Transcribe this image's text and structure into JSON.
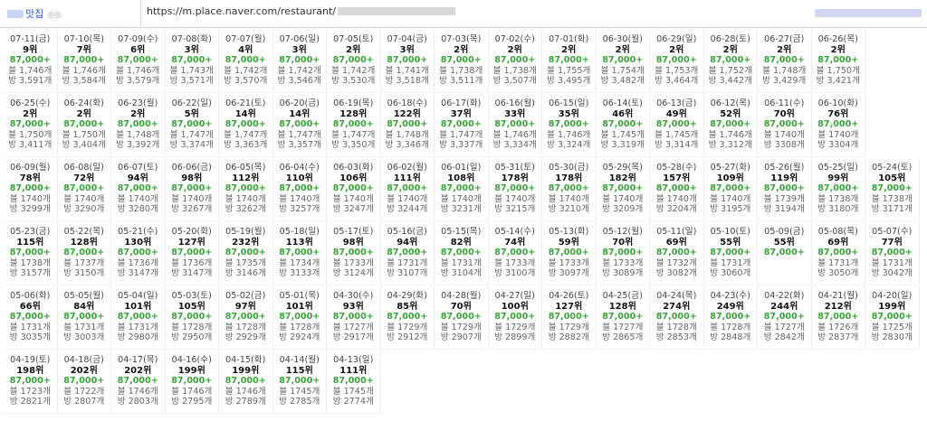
{
  "header": {
    "brand_label": "맛집",
    "brand_extra": "◎◎",
    "url": "https://m.place.naver.com/restaurant/"
  },
  "rows": [
    [
      {
        "date": "07-11(금)",
        "rank": "9위",
        "price": "87,000+",
        "blog": "블 1,746개",
        "visit": "방 3,591개"
      },
      {
        "date": "07-10(목)",
        "rank": "7위",
        "price": "87,000+",
        "blog": "블 1,746개",
        "visit": "방 3,584개"
      },
      {
        "date": "07-09(수)",
        "rank": "6위",
        "price": "87,000+",
        "blog": "블 1,746개",
        "visit": "방 3,579개"
      },
      {
        "date": "07-08(화)",
        "rank": "3위",
        "price": "87,000+",
        "blog": "블 1,743개",
        "visit": "방 3,571개"
      },
      {
        "date": "07-07(월)",
        "rank": "4위",
        "price": "87,000+",
        "blog": "블 1,742개",
        "visit": "방 3,570개"
      },
      {
        "date": "07-06(일)",
        "rank": "3위",
        "price": "87,000+",
        "blog": "블 1,742개",
        "visit": "방 3,546개"
      },
      {
        "date": "07-05(토)",
        "rank": "2위",
        "price": "87,000+",
        "blog": "블 1,742개",
        "visit": "방 3,530개"
      },
      {
        "date": "07-04(금)",
        "rank": "3위",
        "price": "87,000+",
        "blog": "블 1,741개",
        "visit": "방 3,518개"
      },
      {
        "date": "07-03(목)",
        "rank": "2위",
        "price": "87,000+",
        "blog": "블 1,738개",
        "visit": "방 3,511개"
      },
      {
        "date": "07-02(수)",
        "rank": "2위",
        "price": "87,000+",
        "blog": "블 1,738개",
        "visit": "방 3,507개"
      },
      {
        "date": "07-01(화)",
        "rank": "2위",
        "price": "87,000+",
        "blog": "블 1,755개",
        "visit": "방 3,495개"
      },
      {
        "date": "06-30(월)",
        "rank": "2위",
        "price": "87,000+",
        "blog": "블 1,754개",
        "visit": "방 3,482개"
      },
      {
        "date": "06-29(일)",
        "rank": "2위",
        "price": "87,000+",
        "blog": "블 1,753개",
        "visit": "방 3,464개"
      },
      {
        "date": "06-28(토)",
        "rank": "2위",
        "price": "87,000+",
        "blog": "블 1,752개",
        "visit": "방 3,442개"
      },
      {
        "date": "06-27(금)",
        "rank": "2위",
        "price": "87,000+",
        "blog": "블 1,748개",
        "visit": "방 3,429개"
      },
      {
        "date": "06-26(목)",
        "rank": "2위",
        "price": "87,000+",
        "blog": "블 1,750개",
        "visit": "방 3,421개"
      }
    ],
    [
      {
        "date": "06-25(수)",
        "rank": "2위",
        "price": "87,000+",
        "blog": "블 1,750개",
        "visit": "방 3,411개"
      },
      {
        "date": "06-24(화)",
        "rank": "2위",
        "price": "87,000+",
        "blog": "블 1,750개",
        "visit": "방 3,404개"
      },
      {
        "date": "06-23(월)",
        "rank": "2위",
        "price": "87,000+",
        "blog": "블 1,748개",
        "visit": "방 3,392개"
      },
      {
        "date": "06-22(일)",
        "rank": "5위",
        "price": "87,000+",
        "blog": "블 1,747개",
        "visit": "방 3,374개"
      },
      {
        "date": "06-21(토)",
        "rank": "14위",
        "price": "87,000+",
        "blog": "블 1,747개",
        "visit": "방 3,363개"
      },
      {
        "date": "06-20(금)",
        "rank": "14위",
        "price": "87,000+",
        "blog": "블 1,747개",
        "visit": "방 3,357개"
      },
      {
        "date": "06-19(목)",
        "rank": "128위",
        "price": "87,000+",
        "blog": "블 1,747개",
        "visit": "방 3,350개"
      },
      {
        "date": "06-18(수)",
        "rank": "122위",
        "price": "87,000+",
        "blog": "블 1,748개",
        "visit": "방 3,346개"
      },
      {
        "date": "06-17(화)",
        "rank": "37위",
        "price": "87,000+",
        "blog": "블 1,747개",
        "visit": "방 3,337개"
      },
      {
        "date": "06-16(월)",
        "rank": "33위",
        "price": "87,000+",
        "blog": "블 1,746개",
        "visit": "방 3,334개"
      },
      {
        "date": "06-15(일)",
        "rank": "35위",
        "price": "87,000+",
        "blog": "블 1,746개",
        "visit": "방 3,324개"
      },
      {
        "date": "06-14(토)",
        "rank": "46위",
        "price": "87,000+",
        "blog": "블 1,745개",
        "visit": "방 3,319개"
      },
      {
        "date": "06-13(금)",
        "rank": "49위",
        "price": "87,000+",
        "blog": "블 1,745개",
        "visit": "방 3,314개"
      },
      {
        "date": "06-12(목)",
        "rank": "52위",
        "price": "87,000+",
        "blog": "블 1,746개",
        "visit": "방 3,312개"
      },
      {
        "date": "06-11(수)",
        "rank": "70위",
        "price": "87,000+",
        "blog": "블 1740개",
        "visit": "방 3308개"
      },
      {
        "date": "06-10(화)",
        "rank": "76위",
        "price": "87,000+",
        "blog": "블 1740개",
        "visit": "방 3304개"
      }
    ],
    [
      {
        "date": "06-09(월)",
        "rank": "78위",
        "price": "87,000+",
        "blog": "블 1740개",
        "visit": "방 3299개"
      },
      {
        "date": "06-08(일)",
        "rank": "72위",
        "price": "87,000+",
        "blog": "블 1740개",
        "visit": "방 3290개"
      },
      {
        "date": "06-07(토)",
        "rank": "94위",
        "price": "87,000+",
        "blog": "블 1740개",
        "visit": "방 3280개"
      },
      {
        "date": "06-06(금)",
        "rank": "98위",
        "price": "87,000+",
        "blog": "블 1740개",
        "visit": "방 3267개"
      },
      {
        "date": "06-05(목)",
        "rank": "112위",
        "price": "87,000+",
        "blog": "블 1740개",
        "visit": "방 3262개"
      },
      {
        "date": "06-04(수)",
        "rank": "110위",
        "price": "87,000+",
        "blog": "블 1740개",
        "visit": "방 3257개"
      },
      {
        "date": "06-03(화)",
        "rank": "106위",
        "price": "87,000+",
        "blog": "블 1740개",
        "visit": "방 3247개"
      },
      {
        "date": "06-02(월)",
        "rank": "111위",
        "price": "87,000+",
        "blog": "블 1740개",
        "visit": "방 3244개"
      },
      {
        "date": "06-01(일)",
        "rank": "108위",
        "price": "87,000+",
        "blog": "블 1740개",
        "visit": "방 3231개"
      },
      {
        "date": "05-31(토)",
        "rank": "178위",
        "price": "87,000+",
        "blog": "블 1740개",
        "visit": "방 3215개"
      },
      {
        "date": "05-30(금)",
        "rank": "178위",
        "price": "87,000+",
        "blog": "블 1740개",
        "visit": "방 3210개"
      },
      {
        "date": "05-29(목)",
        "rank": "182위",
        "price": "87,000+",
        "blog": "블 1740개",
        "visit": "방 3209개"
      },
      {
        "date": "05-28(수)",
        "rank": "157위",
        "price": "87,000+",
        "blog": "블 1740개",
        "visit": "방 3204개"
      },
      {
        "date": "05-27(화)",
        "rank": "109위",
        "price": "87,000+",
        "blog": "블 1740개",
        "visit": "방 3195개"
      },
      {
        "date": "05-26(월)",
        "rank": "119위",
        "price": "87,000+",
        "blog": "블 1739개",
        "visit": "방 3194개"
      },
      {
        "date": "05-25(일)",
        "rank": "99위",
        "price": "87,000+",
        "blog": "블 1738개",
        "visit": "방 3180개"
      },
      {
        "date": "05-24(토)",
        "rank": "105위",
        "price": "87,000+",
        "blog": "블 1738개",
        "visit": "방 3171개"
      }
    ],
    [
      {
        "date": "05-23(금)",
        "rank": "115위",
        "price": "87,000+",
        "blog": "블 1738개",
        "visit": "방 3157개"
      },
      {
        "date": "05-22(목)",
        "rank": "128위",
        "price": "87,000+",
        "blog": "블 1737개",
        "visit": "방 3150개"
      },
      {
        "date": "05-21(수)",
        "rank": "130위",
        "price": "87,000+",
        "blog": "블 1736개",
        "visit": "방 3147개"
      },
      {
        "date": "05-20(화)",
        "rank": "127위",
        "price": "87,000+",
        "blog": "블 1736개",
        "visit": "방 3147개"
      },
      {
        "date": "05-19(월)",
        "rank": "232위",
        "price": "87,000+",
        "blog": "블 1735개",
        "visit": "방 3146개"
      },
      {
        "date": "05-18(일)",
        "rank": "113위",
        "price": "87,000+",
        "blog": "블 1734개",
        "visit": "방 3133개"
      },
      {
        "date": "05-17(토)",
        "rank": "98위",
        "price": "87,000+",
        "blog": "블 1733개",
        "visit": "방 3124개"
      },
      {
        "date": "05-16(금)",
        "rank": "94위",
        "price": "87,000+",
        "blog": "블 1731개",
        "visit": "방 3107개"
      },
      {
        "date": "05-15(목)",
        "rank": "82위",
        "price": "87,000+",
        "blog": "블 1731개",
        "visit": "방 3104개"
      },
      {
        "date": "05-14(수)",
        "rank": "74위",
        "price": "87,000+",
        "blog": "블 1733개",
        "visit": "방 3100개"
      },
      {
        "date": "05-13(화)",
        "rank": "59위",
        "price": "87,000+",
        "blog": "블 1733개",
        "visit": "방 3097개"
      },
      {
        "date": "05-12(월)",
        "rank": "70위",
        "price": "87,000+",
        "blog": "블 1733개",
        "visit": "방 3089개"
      },
      {
        "date": "05-11(일)",
        "rank": "69위",
        "price": "87,000+",
        "blog": "블 1732개",
        "visit": "방 3082개"
      },
      {
        "date": "05-10(토)",
        "rank": "55위",
        "price": "87,000+",
        "blog": "블 1731개",
        "visit": "방 3060개"
      },
      {
        "date": "05-09(금)",
        "rank": "55위",
        "price": "87,000+",
        "blog": "",
        "visit": ""
      },
      {
        "date": "05-08(목)",
        "rank": "69위",
        "price": "87,000+",
        "blog": "블 1731개",
        "visit": "방 3050개"
      },
      {
        "date": "05-07(수)",
        "rank": "77위",
        "price": "87,000+",
        "blog": "블 1731개",
        "visit": "방 3042개"
      }
    ],
    [
      {
        "date": "05-06(화)",
        "rank": "66위",
        "price": "87,000+",
        "blog": "블 1731개",
        "visit": "방 3035개"
      },
      {
        "date": "05-05(월)",
        "rank": "84위",
        "price": "87,000+",
        "blog": "블 1731개",
        "visit": "방 3003개"
      },
      {
        "date": "05-04(일)",
        "rank": "101위",
        "price": "87,000+",
        "blog": "블 1731개",
        "visit": "방 2980개"
      },
      {
        "date": "05-03(토)",
        "rank": "105위",
        "price": "87,000+",
        "blog": "블 1728개",
        "visit": "방 2950개"
      },
      {
        "date": "05-02(금)",
        "rank": "97위",
        "price": "87,000+",
        "blog": "블 1728개",
        "visit": "방 2929개"
      },
      {
        "date": "05-01(목)",
        "rank": "101위",
        "price": "87,000+",
        "blog": "블 1728개",
        "visit": "방 2924개"
      },
      {
        "date": "04-30(수)",
        "rank": "93위",
        "price": "87,000+",
        "blog": "블 1727개",
        "visit": "방 2917개"
      },
      {
        "date": "04-29(화)",
        "rank": "85위",
        "price": "87,000+",
        "blog": "블 1729개",
        "visit": "방 2912개"
      },
      {
        "date": "04-28(월)",
        "rank": "70위",
        "price": "87,000+",
        "blog": "블 1729개",
        "visit": "방 2907개"
      },
      {
        "date": "04-27(일)",
        "rank": "100위",
        "price": "87,000+",
        "blog": "블 1729개",
        "visit": "방 2899개"
      },
      {
        "date": "04-26(토)",
        "rank": "127위",
        "price": "87,000+",
        "blog": "블 1729개",
        "visit": "방 2882개"
      },
      {
        "date": "04-25(금)",
        "rank": "128위",
        "price": "87,000+",
        "blog": "블 1727개",
        "visit": "방 2865개"
      },
      {
        "date": "04-24(목)",
        "rank": "274위",
        "price": "87,000+",
        "blog": "블 1728개",
        "visit": "방 2853개"
      },
      {
        "date": "04-23(수)",
        "rank": "249위",
        "price": "87,000+",
        "blog": "블 1728개",
        "visit": "방 2848개"
      },
      {
        "date": "04-22(화)",
        "rank": "244위",
        "price": "87,000+",
        "blog": "블 1727개",
        "visit": "방 2842개"
      },
      {
        "date": "04-21(월)",
        "rank": "212위",
        "price": "87,000+",
        "blog": "블 1726개",
        "visit": "방 2837개"
      },
      {
        "date": "04-20(일)",
        "rank": "199위",
        "price": "87,000+",
        "blog": "블 1725개",
        "visit": "방 2830개"
      }
    ],
    [
      {
        "date": "04-19(토)",
        "rank": "198위",
        "price": "87,000+",
        "blog": "블 1723개",
        "visit": "방 2821개"
      },
      {
        "date": "04-18(금)",
        "rank": "202위",
        "price": "87,000+",
        "blog": "블 1722개",
        "visit": "방 2807개"
      },
      {
        "date": "04-17(목)",
        "rank": "202위",
        "price": "87,000+",
        "blog": "블 1746개",
        "visit": "방 2803개"
      },
      {
        "date": "04-16(수)",
        "rank": "199위",
        "price": "87,000+",
        "blog": "블 1746개",
        "visit": "방 2795개"
      },
      {
        "date": "04-15(화)",
        "rank": "199위",
        "price": "87,000+",
        "blog": "블 1746개",
        "visit": "방 2789개"
      },
      {
        "date": "04-14(월)",
        "rank": "115위",
        "price": "87,000+",
        "blog": "블 1745개",
        "visit": "방 2785개"
      },
      {
        "date": "04-13(일)",
        "rank": "111위",
        "price": "87,000+",
        "blog": "블 1745개",
        "visit": "방 2774개"
      }
    ]
  ]
}
